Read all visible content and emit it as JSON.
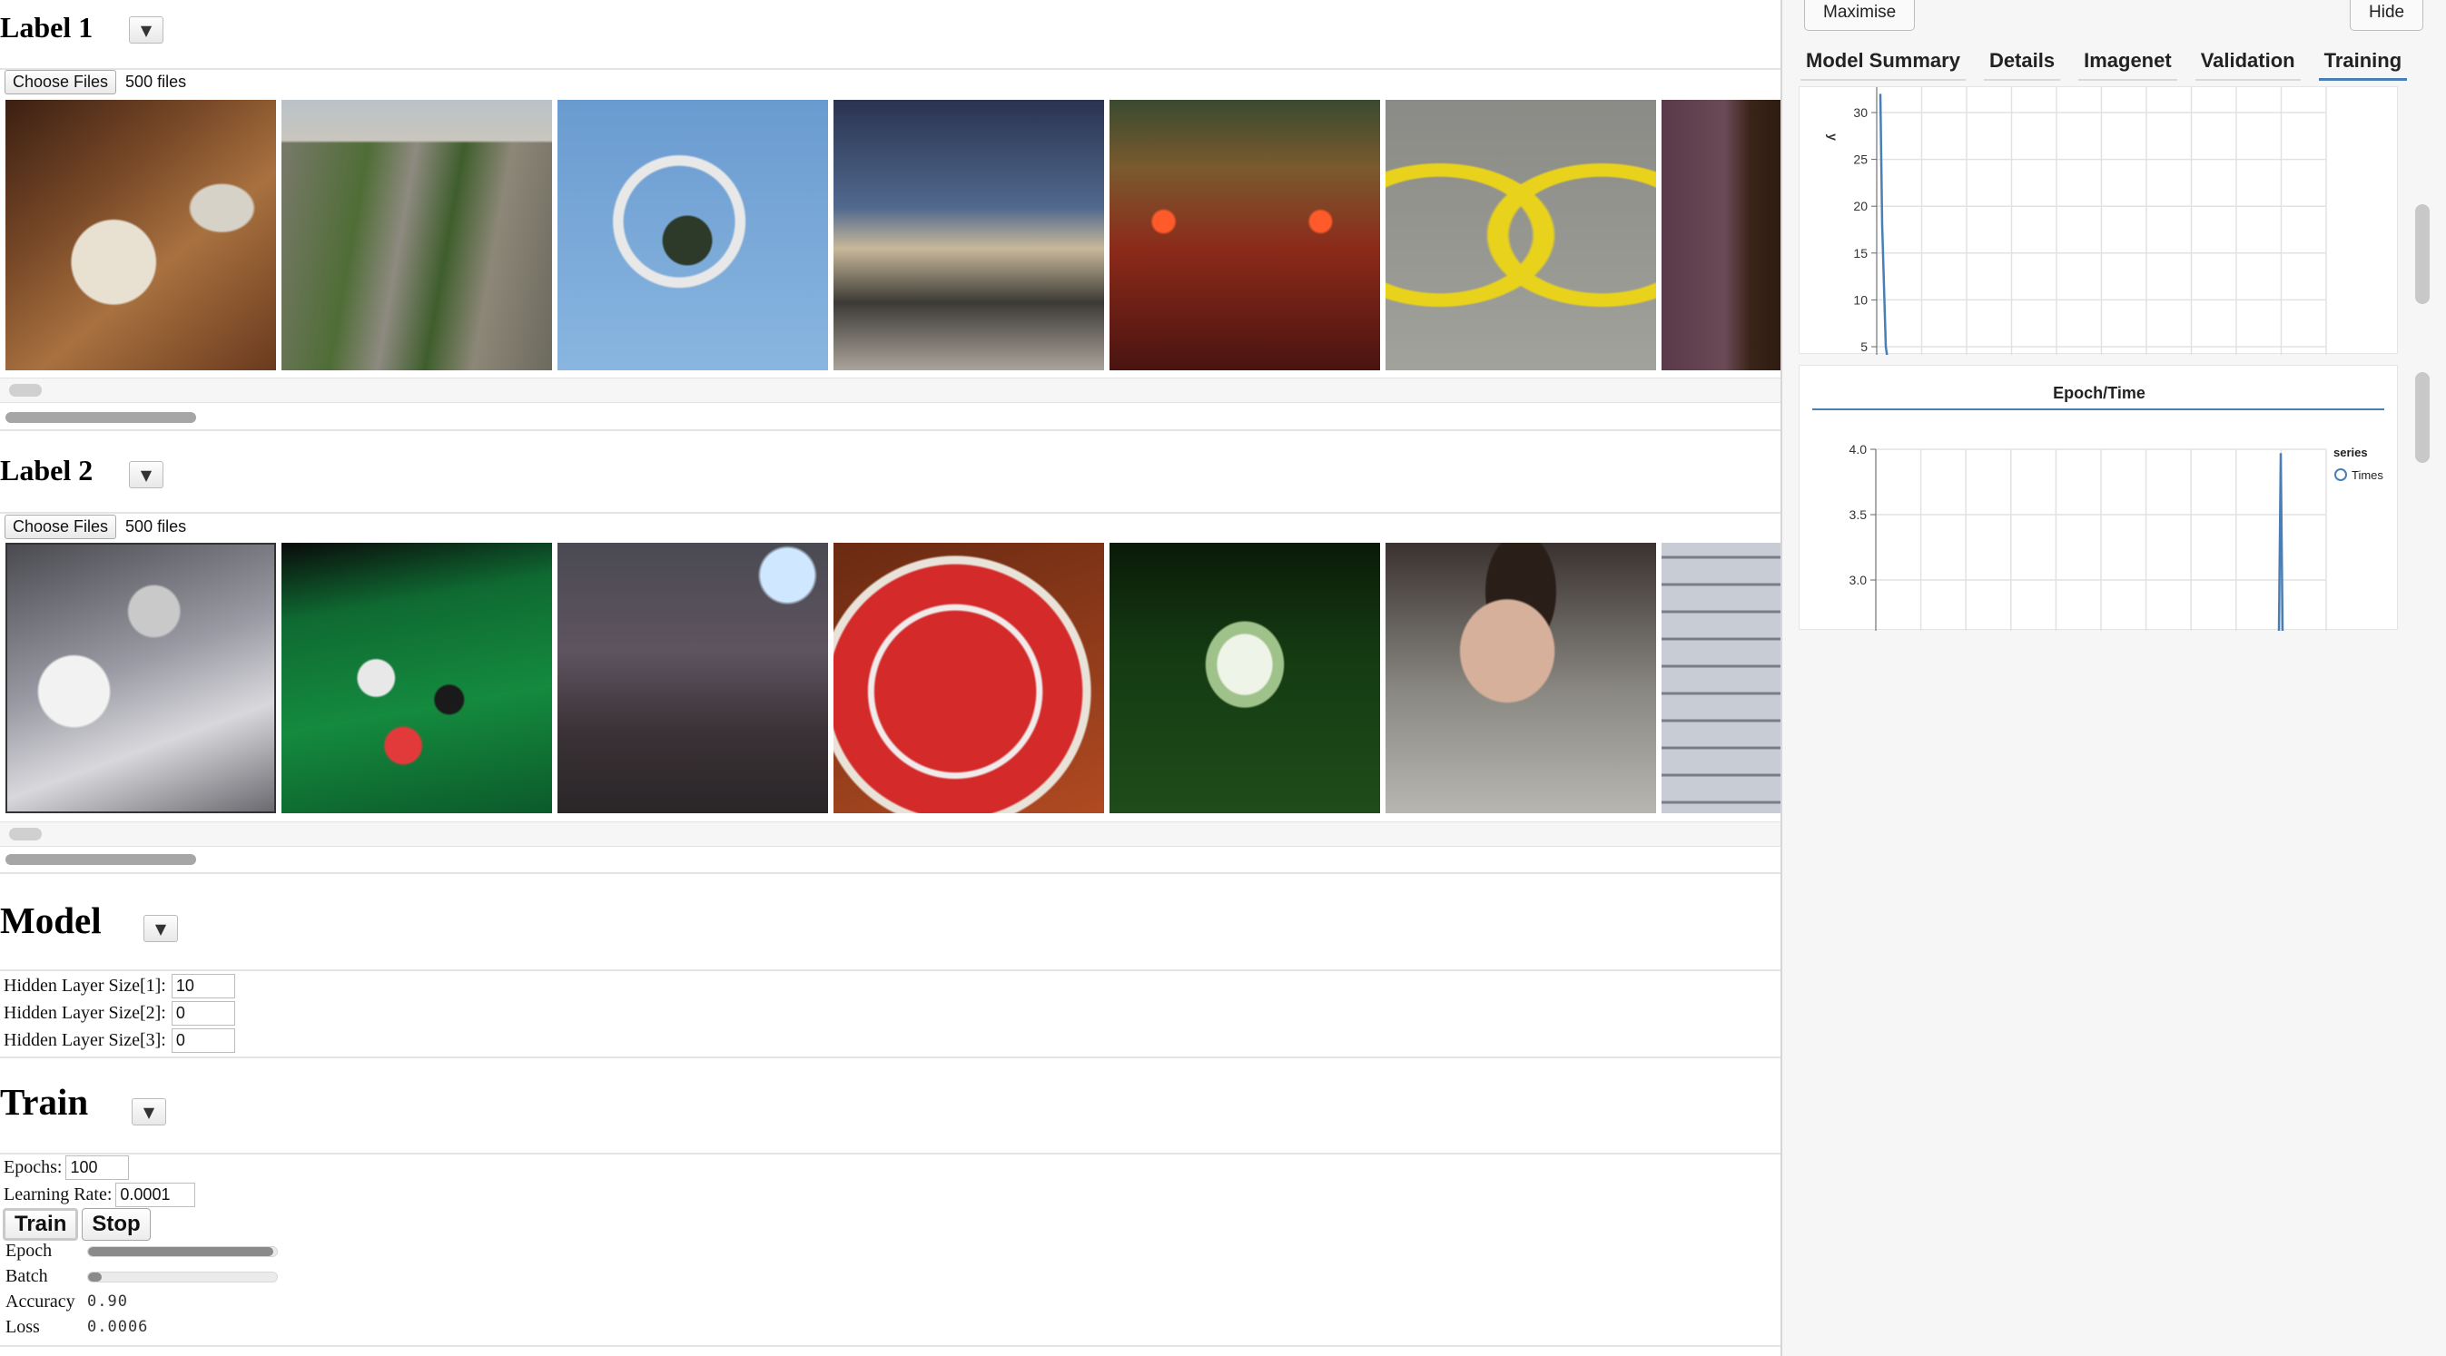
{
  "left": {
    "label1": {
      "title": "Label 1",
      "choose_label": "Choose Files",
      "file_count": "500 files"
    },
    "label2": {
      "title": "Label 2",
      "choose_label": "Choose Files",
      "file_count": "500 files"
    },
    "model": {
      "title": "Model",
      "fields": [
        {
          "label": "Hidden Layer Size[1]:",
          "value": "10"
        },
        {
          "label": "Hidden Layer Size[2]:",
          "value": "0"
        },
        {
          "label": "Hidden Layer Size[3]:",
          "value": "0"
        }
      ]
    },
    "train": {
      "title": "Train",
      "epochs_label": "Epochs:",
      "epochs_value": "100",
      "lr_label": "Learning Rate:",
      "lr_value": "0.0001",
      "train_button": "Train",
      "stop_button": "Stop",
      "epoch_label": "Epoch",
      "epoch_progress": 0.98,
      "batch_label": "Batch",
      "batch_progress": 0.07,
      "accuracy_label": "Accuracy",
      "accuracy_value": "0.90",
      "loss_label": "Loss",
      "loss_value": "0.0006"
    },
    "collapse_glyph": "▼"
  },
  "right": {
    "maximise_label": "Maximise",
    "hide_label": "Hide",
    "tabs": [
      "Model Summary",
      "Details",
      "Imagenet",
      "Validation",
      "Training"
    ],
    "active_tab": "Training",
    "accent": "#4a7fb5"
  },
  "chart_data": [
    {
      "type": "line",
      "title": "",
      "ylabel": "y",
      "yticks": [
        5,
        10,
        15,
        20,
        25,
        30
      ],
      "series": [
        {
          "x": [
            0,
            0.2
          ],
          "values": [
            32,
            5
          ]
        }
      ]
    },
    {
      "type": "line",
      "title": "Epoch/Time",
      "legend_title": "series",
      "legend_position": "top-right",
      "yticks": [
        "3.0",
        "3.5",
        "4.0"
      ],
      "series": [
        {
          "name": "Times",
          "x": [
            9.0,
            9.1,
            9.2
          ],
          "values": [
            2.8,
            3.97,
            2.8
          ]
        }
      ]
    }
  ]
}
